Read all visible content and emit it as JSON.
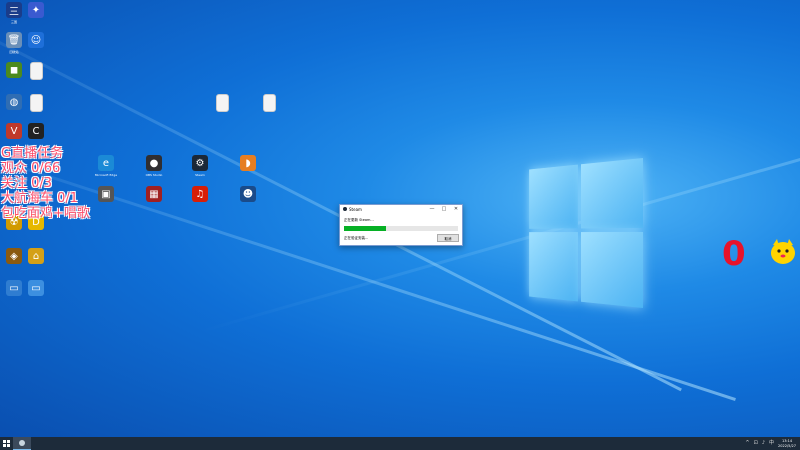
{
  "desktop": {
    "icons": [
      {
        "id": "game-wangzhe",
        "label": "三国",
        "glyph": "三",
        "color": "#1a3c8a"
      },
      {
        "id": "ai-app",
        "label": "",
        "glyph": "✦",
        "color": "#3a5ad0"
      },
      {
        "id": "recycle-bin",
        "label": "回收站",
        "glyph": "🗑",
        "color": "#6a8fb8"
      },
      {
        "id": "app-blue-person",
        "label": "",
        "glyph": "☺",
        "color": "#1e6fd9"
      },
      {
        "id": "nvidia-app",
        "label": "",
        "glyph": "◼",
        "color": "#4c8a1e"
      },
      {
        "id": "text-file-1",
        "label": "",
        "glyph": "",
        "color": "#f4f4f4"
      },
      {
        "id": "network",
        "label": "",
        "glyph": "◍",
        "color": "#2f6db3"
      },
      {
        "id": "text-file-2",
        "label": "",
        "glyph": "",
        "color": "#f4f4f4"
      },
      {
        "id": "app-red-v",
        "label": "",
        "glyph": "V",
        "color": "#c0392b"
      },
      {
        "id": "app-black-c",
        "label": "",
        "glyph": "C",
        "color": "#222"
      },
      {
        "id": "app-edge",
        "label": "Microsoft Edge",
        "glyph": "e",
        "color": "#1b8ad6"
      },
      {
        "id": "obs",
        "label": "OBS Studio",
        "glyph": "●",
        "color": "#302e31"
      },
      {
        "id": "steam",
        "label": "Steam",
        "glyph": "⚙",
        "color": "#1b2838"
      },
      {
        "id": "app-orange-bird",
        "label": "",
        "glyph": "◗",
        "color": "#e67e22"
      },
      {
        "id": "app-box",
        "label": "",
        "glyph": "▣",
        "color": "#555"
      },
      {
        "id": "app-red-square",
        "label": "",
        "glyph": "▦",
        "color": "#a02020"
      },
      {
        "id": "netease-music",
        "label": "",
        "glyph": "♫",
        "color": "#d81e06"
      },
      {
        "id": "app-globe-person",
        "label": "",
        "glyph": "☻",
        "color": "#1a4b8a"
      },
      {
        "id": "app-yellow-1",
        "label": "",
        "glyph": "☢",
        "color": "#d19a00"
      },
      {
        "id": "app-yellow-d",
        "label": "",
        "glyph": "D",
        "color": "#e6b800"
      },
      {
        "id": "app-game-1",
        "label": "",
        "glyph": "◈",
        "color": "#8a5a10"
      },
      {
        "id": "app-house",
        "label": "",
        "glyph": "⌂",
        "color": "#d4a017"
      },
      {
        "id": "app-folder-1",
        "label": "",
        "glyph": "▭",
        "color": "#2f7dd1"
      },
      {
        "id": "app-folder-2",
        "label": "",
        "glyph": "▭",
        "color": "#3c8fe0"
      },
      {
        "id": "text-file-3",
        "label": "",
        "glyph": "",
        "color": "#f4f4f4"
      },
      {
        "id": "text-file-4",
        "label": "",
        "glyph": "",
        "color": "#f4f4f4"
      }
    ]
  },
  "overlay": {
    "lines": [
      "G直播任务",
      "观众 0/66",
      "关注 0/3",
      "大航海车 0/1",
      "包吃面鸡+唱歌"
    ],
    "counter": "0"
  },
  "steam_dialog": {
    "title": "Steam",
    "status_line1": "正在更新 Steam...",
    "status_line2": "正在验证安装...",
    "progress": 0.37,
    "cancel_label": "取消",
    "minimize": "—",
    "maximize": "□",
    "close": "✕"
  },
  "taskbar": {
    "clock_time": "13:14",
    "clock_date": "2022/5/27",
    "tray_icons": [
      "^",
      "⊡",
      "♪",
      "中"
    ]
  },
  "colors": {
    "accent": "#06b025",
    "taskbar": "#1d2b3a",
    "overlay_text": "#ff4e6a"
  }
}
